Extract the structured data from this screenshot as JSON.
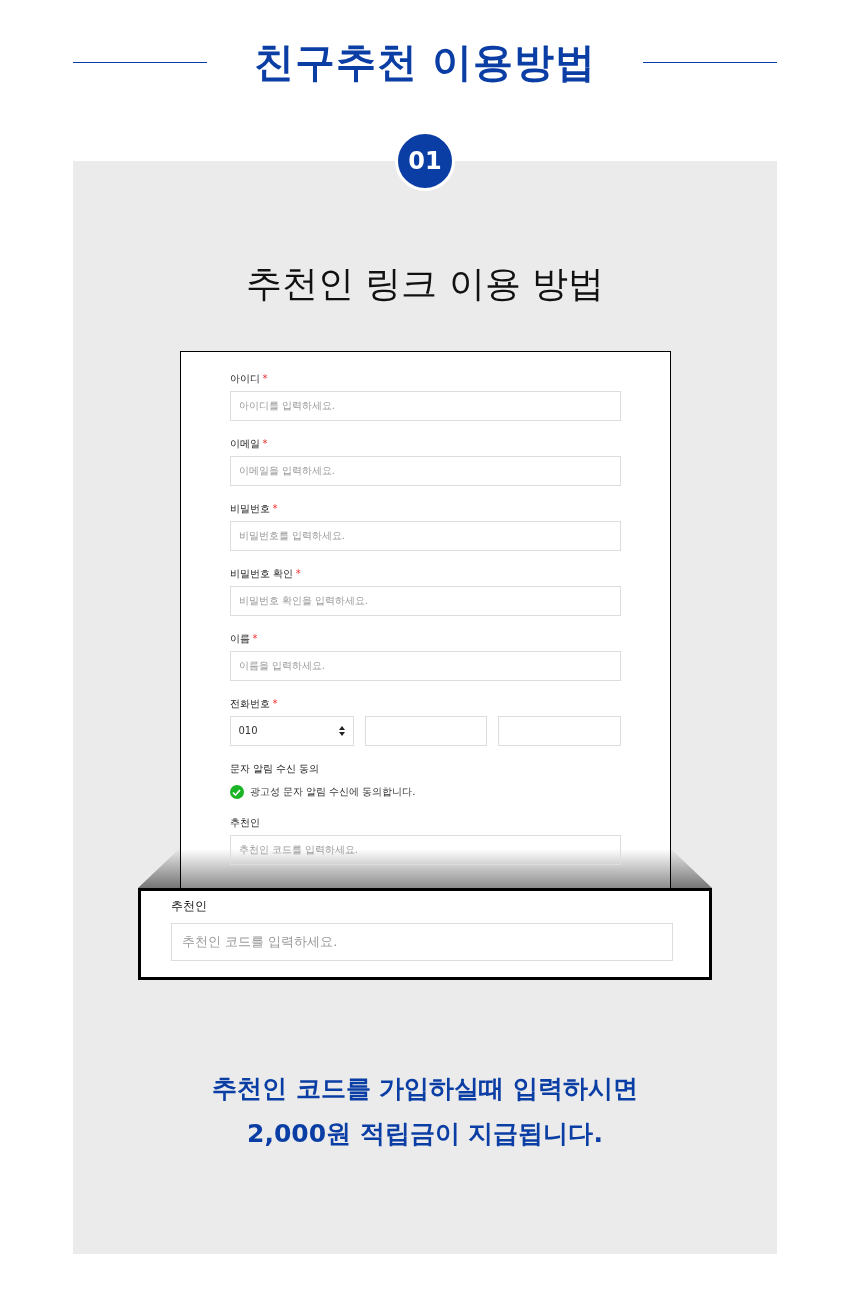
{
  "title": "친구추천 이용방법",
  "step": {
    "number": "01",
    "title": "추천인 링크 이용 방법"
  },
  "form": {
    "fields": [
      {
        "kind": "text",
        "label": "아이디",
        "required_mark": "*",
        "placeholder": "아이디를 입력하세요."
      },
      {
        "kind": "text",
        "label": "이메일",
        "required_mark": "*",
        "placeholder": "이메일을 입력하세요."
      },
      {
        "kind": "text",
        "label": "비밀번호",
        "required_mark": "*",
        "placeholder": "비밀번호를 입력하세요."
      },
      {
        "kind": "text",
        "label": "비밀번호 확인",
        "required_mark": "*",
        "placeholder": "비밀번호 확인을 입력하세요."
      },
      {
        "kind": "text",
        "label": "이름",
        "required_mark": "*",
        "placeholder": "이름을 입력하세요."
      },
      {
        "kind": "phone",
        "label": "전화번호",
        "required_mark": "*",
        "prefix": "010"
      },
      {
        "kind": "consent",
        "label": "문자 알림 수신 동의",
        "option": "광고성 문자 알림 수신에 동의합니다.",
        "checked": true
      },
      {
        "kind": "text",
        "label": "추천인",
        "placeholder": "추천인 코드를 입력하세요."
      }
    ]
  },
  "zoom": {
    "label": "추천인",
    "placeholder": "추천인 코드를 입력하세요."
  },
  "description": [
    "추천인 코드를 가입하실때 입력하시면",
    "2,000원 적립금이 지급됩니다."
  ]
}
